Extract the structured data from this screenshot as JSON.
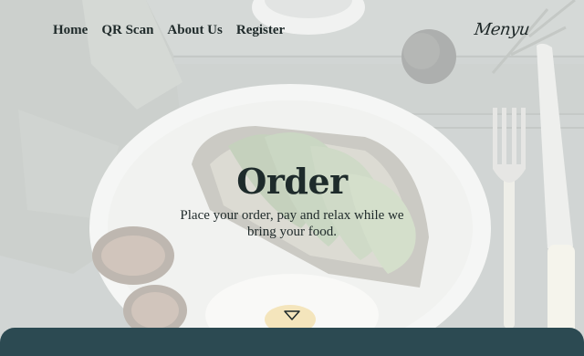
{
  "nav": {
    "items": [
      {
        "label": "Home"
      },
      {
        "label": "QR Scan"
      },
      {
        "label": "About Us"
      },
      {
        "label": "Register"
      }
    ]
  },
  "brand": {
    "logo_text": "Menyu"
  },
  "hero": {
    "title": "Order",
    "subtitle": "Place your order, pay and relax while we bring your food."
  },
  "icons": {
    "scroll": "triangle-down-icon"
  },
  "colors": {
    "panel": "#2c4a52",
    "text": "#1f2a2a"
  }
}
